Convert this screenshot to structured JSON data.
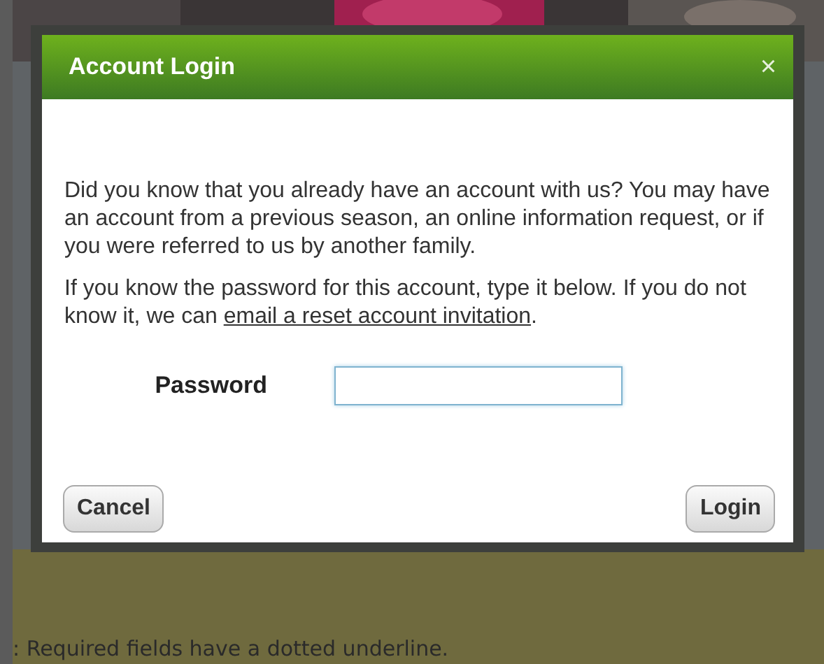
{
  "background": {
    "note": ": Required fields have a dotted underline."
  },
  "dialog": {
    "title": "Account Login",
    "close": "×",
    "intro": "Did you know that you already have an account with us? You may have an account from a previous season, an online information request, or if you were referred to us by another family.",
    "instructions": "If you know the password for this account, type it below. If you do not know it, we can",
    "link": "email a reset account invitation",
    "after_link": ".",
    "password_label": "Password",
    "buttons": [
      {
        "label": "Cancel"
      },
      {
        "label": "Login"
      }
    ]
  }
}
